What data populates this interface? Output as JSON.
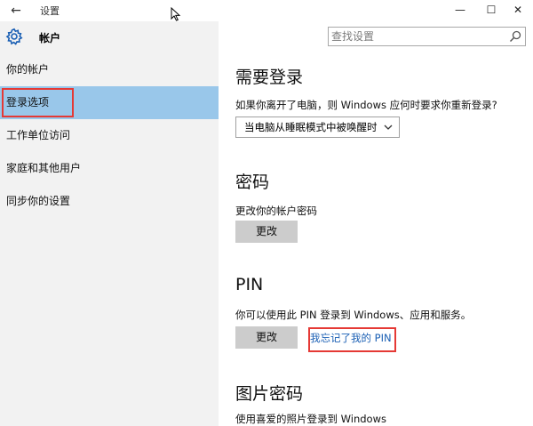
{
  "window": {
    "title": "设置",
    "back_glyph": "←",
    "minimize_glyph": "—",
    "maximize_glyph": "☐",
    "close_glyph": "✕"
  },
  "sidebar": {
    "page_title": "帐户",
    "page_icon": "gear-icon",
    "selected_index": 1,
    "items": [
      {
        "label": "你的帐户"
      },
      {
        "label": "登录选项"
      },
      {
        "label": "工作单位访问"
      },
      {
        "label": "家庭和其他用户"
      },
      {
        "label": "同步你的设置"
      }
    ]
  },
  "search": {
    "placeholder": "查找设置",
    "icon": "search-icon"
  },
  "content": {
    "signin": {
      "title": "需要登录",
      "description": "如果你离开了电脑，则 Windows 应何时要求你重新登录?",
      "select_value": "当电脑从睡眠模式中被唤醒时"
    },
    "password": {
      "title": "密码",
      "description": "更改你的帐户密码",
      "change_label": "更改"
    },
    "pin": {
      "title": "PIN",
      "description": "你可以使用此 PIN 登录到 Windows、应用和服务。",
      "change_label": "更改",
      "forgot_link": "我忘记了我的 PIN"
    },
    "picture_password": {
      "title": "图片密码",
      "description": "使用喜爱的照片登录到 Windows"
    }
  },
  "colors": {
    "sidebar_bg": "#f2f2f2",
    "selected_bg": "#99c7ea",
    "highlight_border": "#e53935",
    "link": "#1a5fb4",
    "button_bg": "#cccccc"
  }
}
